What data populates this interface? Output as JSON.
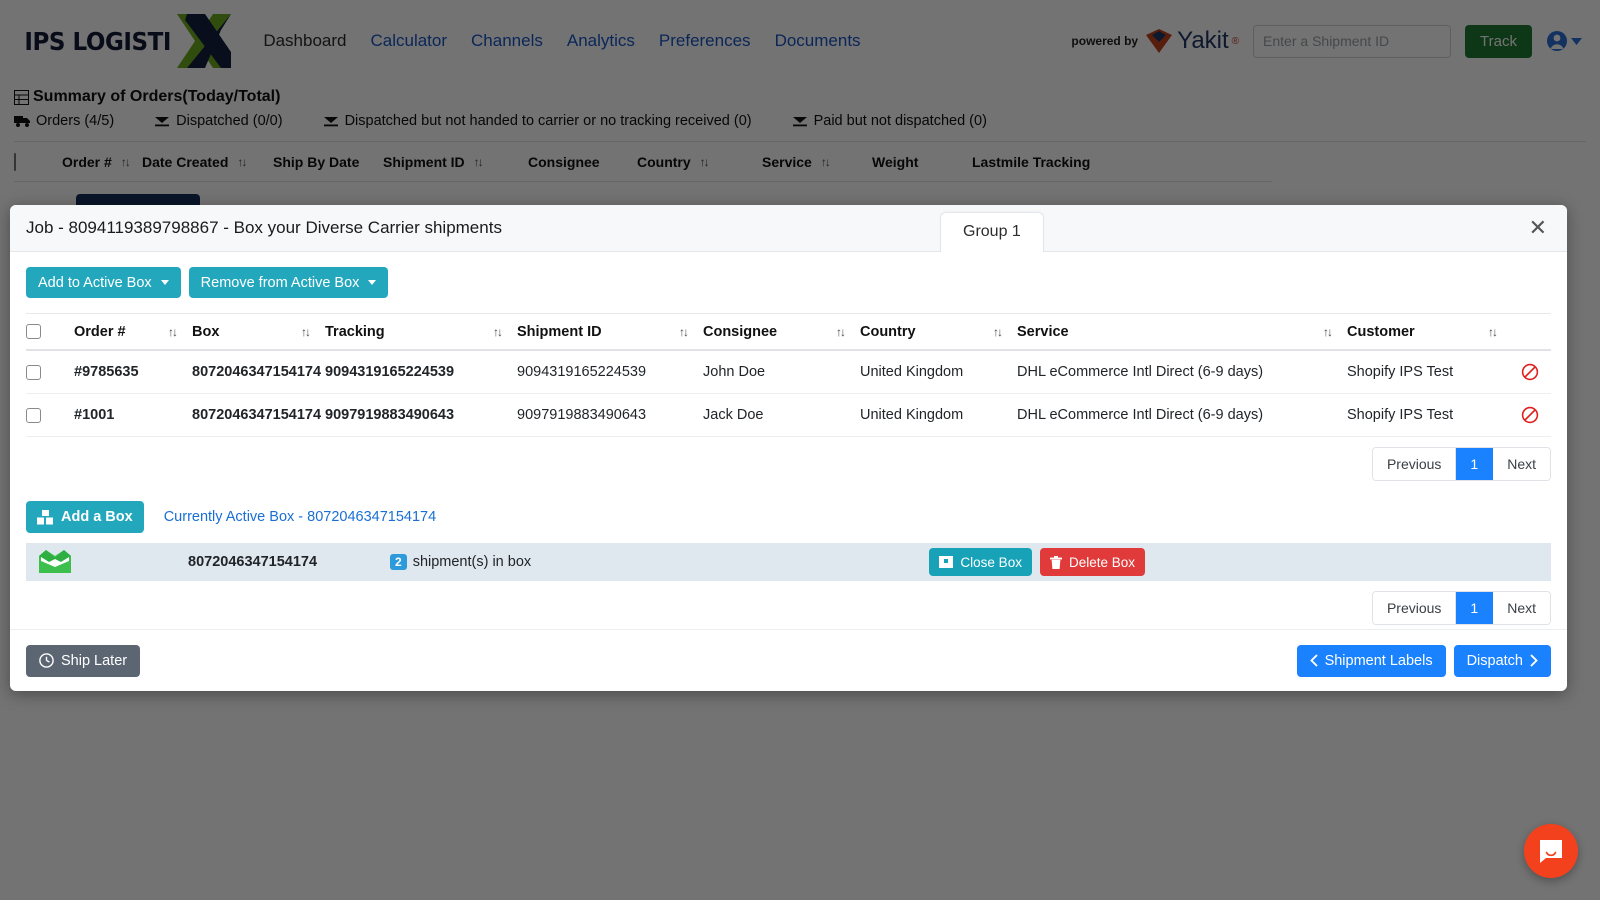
{
  "navbar": {
    "brand_text": "IPS LOGISTI",
    "brand_mark": "x-logo-icon",
    "links": [
      {
        "label": "Dashboard",
        "active": true
      },
      {
        "label": "Calculator",
        "active": false
      },
      {
        "label": "Channels",
        "active": false
      },
      {
        "label": "Analytics",
        "active": false
      },
      {
        "label": "Preferences",
        "active": false
      },
      {
        "label": "Documents",
        "active": false
      }
    ],
    "powered_by_label": "powered by",
    "powered_by_brand": "Yakit",
    "powered_by_tm": "®",
    "shipment_input_placeholder": "Enter a Shipment ID",
    "shipment_input_value": "",
    "track_button": "Track",
    "account_icon": "account-circle-icon",
    "track_color": "#1e7b32"
  },
  "summary": {
    "title": "Summary of Orders(Today/Total)",
    "items": [
      {
        "icon": "truck-icon",
        "label": "Orders (4/5)"
      },
      {
        "icon": "dispatch-icon",
        "label": "Dispatched (0/0)"
      },
      {
        "icon": "dispatch-icon",
        "label": "Dispatched but not handed to carrier or no tracking received (0)"
      },
      {
        "icon": "dispatch-icon",
        "label": "Paid but not dispatched (0)"
      }
    ]
  },
  "background_table": {
    "columns": [
      "Order #",
      "Date Created",
      "Ship By Date",
      "Shipment ID",
      "Consignee",
      "Country",
      "Service",
      "Weight",
      "Lastmile Tracking"
    ]
  },
  "modal": {
    "title": "Job - 8094119389798867 - Box your Diverse Carrier shipments",
    "tab_label": "Group 1",
    "close_icon": "close-icon",
    "toolbar": {
      "add_to_active_box": "Add to Active Box",
      "remove_from_active_box": "Remove from Active Box"
    },
    "table": {
      "columns": [
        {
          "label": "Order #",
          "sortable": true
        },
        {
          "label": "Box",
          "sortable": true
        },
        {
          "label": "Tracking",
          "sortable": true
        },
        {
          "label": "Shipment ID",
          "sortable": true
        },
        {
          "label": "Consignee",
          "sortable": true
        },
        {
          "label": "Country",
          "sortable": true
        },
        {
          "label": "Service",
          "sortable": true
        },
        {
          "label": "Customer",
          "sortable": true
        }
      ],
      "rows": [
        {
          "order": "#9785635",
          "box": "8072046347154174",
          "tracking": "9094319165224539",
          "shipment_id": "9094319165224539",
          "consignee": "John Doe",
          "country": "United Kingdom",
          "service": "DHL eCommerce Intl Direct (6-9 days)",
          "customer": "Shopify IPS Test",
          "action_icon": "ban-icon"
        },
        {
          "order": "#1001",
          "box": "8072046347154174",
          "tracking": "9097919883490643",
          "shipment_id": "9097919883490643",
          "consignee": "Jack Doe",
          "country": "United Kingdom",
          "service": "DHL eCommerce Intl Direct (6-9 days)",
          "customer": "Shopify IPS Test",
          "action_icon": "ban-icon"
        }
      ]
    },
    "pagination_top": {
      "previous": "Previous",
      "page": "1",
      "next": "Next"
    },
    "pagination_bottom": {
      "previous": "Previous",
      "page": "1",
      "next": "Next"
    },
    "boxes": {
      "add_box_button": "Add a Box",
      "active_box_link": "Currently Active Box - 8072046347154174",
      "row": {
        "box_icon": "open-box-icon",
        "box_number": "8072046347154174",
        "count_badge": "2",
        "count_label": "shipment(s) in box",
        "close_box_button": "Close Box",
        "delete_box_button": "Delete Box"
      }
    },
    "footer": {
      "ship_later": "Ship Later",
      "shipment_labels": "Shipment Labels",
      "dispatch": "Dispatch"
    },
    "colors": {
      "teal": "#23a7bd",
      "blue": "#1a82ff",
      "red": "#e03a3a",
      "slate": "#5c6673"
    }
  },
  "chat": {
    "icon": "chat-bubble-icon",
    "color": "#f4411d"
  }
}
